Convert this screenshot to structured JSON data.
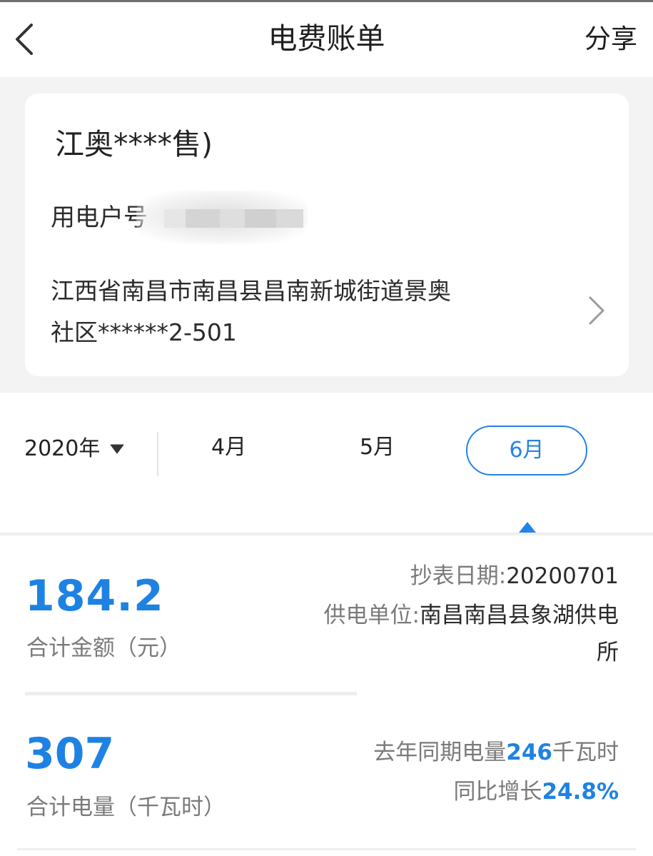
{
  "header": {
    "back_icon": "chevron-left-icon",
    "title": "电费账单",
    "share_label": "分享"
  },
  "account": {
    "name": "江奥****售)",
    "account_no_label": "用电户号",
    "address_line1": "江西省南昌市南昌县昌南新城街道景奥",
    "address_line2": "社区******2-501",
    "detail_icon": "chevron-right-icon"
  },
  "period": {
    "year": "2020年",
    "year_caret_icon": "caret-down-icon",
    "months": [
      "4月",
      "5月",
      "6月"
    ],
    "selected_month": "6月",
    "accent_color": "#2383e6"
  },
  "bill": {
    "amount": "184.2",
    "amount_label": "合计金额（元）",
    "read_date_label": "抄表日期:",
    "read_date": "20200701",
    "supply_unit_label": "供电单位:",
    "supply_unit": "南昌南昌县象湖供电所",
    "energy": "307",
    "energy_label": "合计电量（千瓦时）",
    "last_year_prefix": "去年同期电量",
    "last_year_value": "246",
    "last_year_unit": "千瓦时",
    "yoy_prefix": "同比增长",
    "yoy_value": "24.8%",
    "value_color": "#1e82e2"
  }
}
